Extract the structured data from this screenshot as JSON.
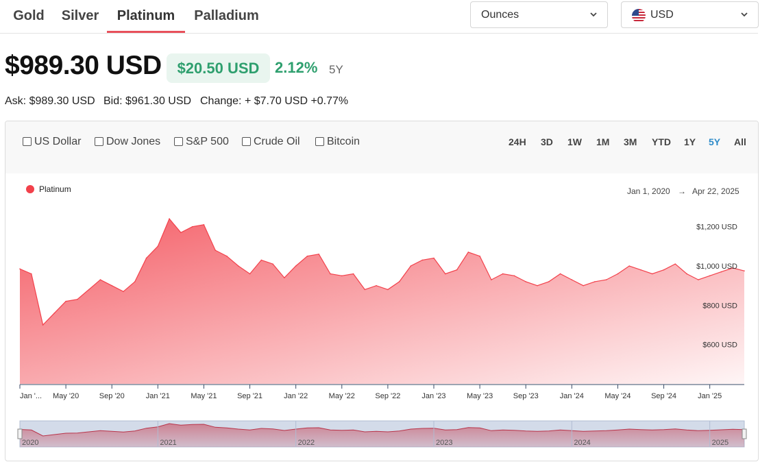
{
  "tabs": [
    {
      "label": "Gold",
      "active": false
    },
    {
      "label": "Silver",
      "active": false
    },
    {
      "label": "Platinum",
      "active": true
    },
    {
      "label": "Palladium",
      "active": false
    }
  ],
  "unit_select": {
    "value": "Ounces"
  },
  "currency_select": {
    "value": "USD",
    "flag_icon": "us-flag-icon"
  },
  "price": {
    "value": "$989.30 USD",
    "change": "$20.50 USD",
    "change_pct": "2.12%",
    "period": "5Y",
    "ask": "Ask: $989.30 USD",
    "bid": "Bid: $961.30 USD",
    "daily_change": "Change: + $7.70 USD +0.77%"
  },
  "compare": [
    "US Dollar",
    "Dow Jones",
    "S&P 500",
    "Crude Oil",
    "Bitcoin"
  ],
  "ranges": [
    "24H",
    "3D",
    "1W",
    "1M",
    "3M",
    "YTD",
    "1Y",
    "5Y",
    "All"
  ],
  "active_range": "5Y",
  "date_range": {
    "from": "Jan 1, 2020",
    "arrow": "→",
    "to": "Apr 22, 2025"
  },
  "colors": {
    "accent": "#f2414b",
    "positive": "#2e9f6e",
    "active_range": "#2e8bc9"
  },
  "chart_data": {
    "type": "area",
    "series": [
      {
        "name": "Platinum"
      }
    ],
    "x": [
      "2020-01",
      "2020-02",
      "2020-03",
      "2020-04",
      "2020-05",
      "2020-06",
      "2020-07",
      "2020-08",
      "2020-09",
      "2020-10",
      "2020-11",
      "2020-12",
      "2021-01",
      "2021-02",
      "2021-03",
      "2021-04",
      "2021-05",
      "2021-06",
      "2021-07",
      "2021-08",
      "2021-09",
      "2021-10",
      "2021-11",
      "2021-12",
      "2022-01",
      "2022-02",
      "2022-03",
      "2022-04",
      "2022-05",
      "2022-06",
      "2022-07",
      "2022-08",
      "2022-09",
      "2022-10",
      "2022-11",
      "2022-12",
      "2023-01",
      "2023-02",
      "2023-03",
      "2023-04",
      "2023-05",
      "2023-06",
      "2023-07",
      "2023-08",
      "2023-09",
      "2023-10",
      "2023-11",
      "2023-12",
      "2024-01",
      "2024-02",
      "2024-03",
      "2024-04",
      "2024-05",
      "2024-06",
      "2024-07",
      "2024-08",
      "2024-09",
      "2024-10",
      "2024-11",
      "2024-12",
      "2025-01",
      "2025-02",
      "2025-03",
      "2025-04"
    ],
    "values": [
      985,
      960,
      700,
      760,
      820,
      830,
      880,
      930,
      900,
      870,
      920,
      1040,
      1100,
      1240,
      1170,
      1200,
      1210,
      1080,
      1050,
      1000,
      960,
      1030,
      1010,
      940,
      1000,
      1050,
      1060,
      960,
      950,
      960,
      880,
      900,
      880,
      920,
      1000,
      1030,
      1040,
      960,
      980,
      1070,
      1050,
      930,
      960,
      950,
      920,
      900,
      920,
      960,
      930,
      900,
      920,
      930,
      960,
      1000,
      980,
      960,
      980,
      1010,
      960,
      930,
      950,
      970,
      990,
      975
    ],
    "ylim": [
      400,
      1300
    ],
    "yticks": [
      "$600 USD",
      "$800 USD",
      "$1,000 USD",
      "$1,200 USD"
    ],
    "ytick_values": [
      600,
      800,
      1000,
      1200
    ],
    "xticks": [
      "Jan '...",
      "May '20",
      "Sep '20",
      "Jan '21",
      "May '21",
      "Sep '21",
      "Jan '22",
      "May '22",
      "Sep '22",
      "Jan '23",
      "May '23",
      "Sep '23",
      "Jan '24",
      "May '24",
      "Sep '24",
      "Jan '25"
    ],
    "xtick_index": [
      0,
      4,
      8,
      12,
      16,
      20,
      24,
      28,
      32,
      36,
      40,
      44,
      48,
      52,
      56,
      60
    ],
    "navigator_labels": [
      "2020",
      "2021",
      "2022",
      "2023",
      "2024",
      "2025"
    ],
    "navigator_index": [
      0,
      12,
      24,
      36,
      48,
      60
    ],
    "grid": false,
    "legend": "top-left"
  }
}
